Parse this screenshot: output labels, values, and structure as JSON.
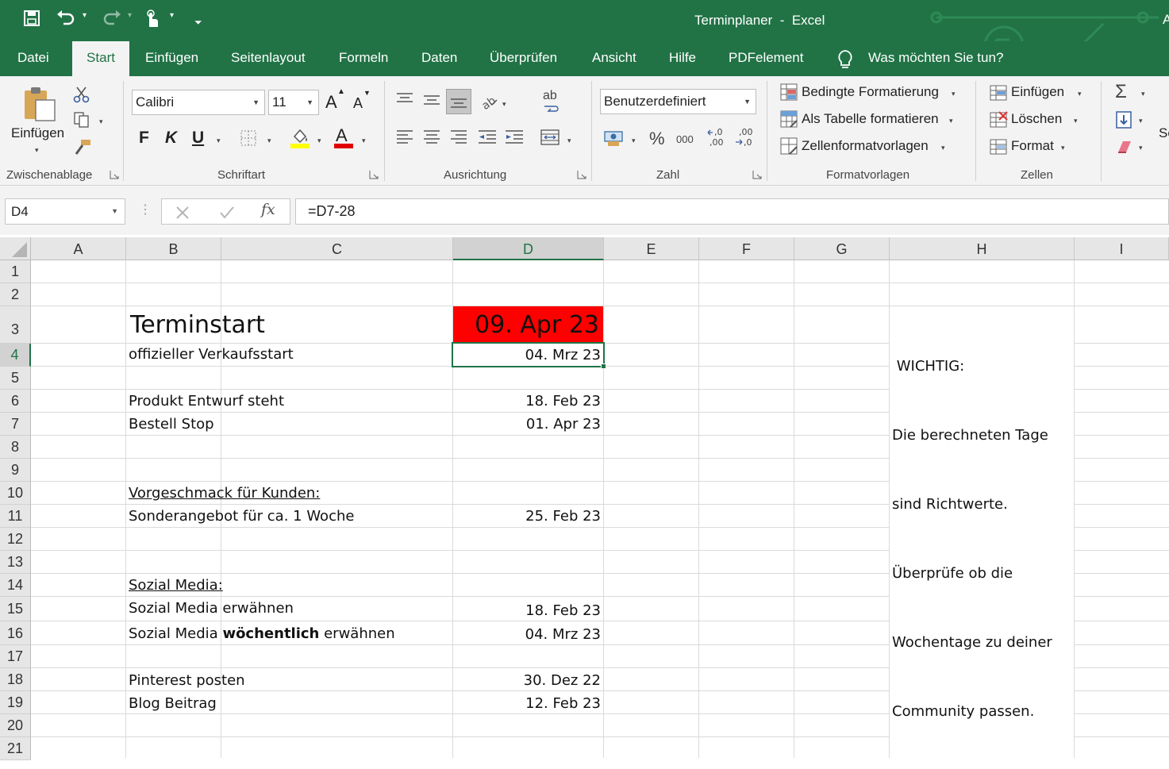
{
  "window": {
    "title": "Terminplaner  -  Excel",
    "title_right_fragment": "A"
  },
  "quick_access": [
    "save-icon",
    "undo-icon",
    "redo-icon",
    "touch-mode-icon",
    "customize-qat-icon"
  ],
  "tabs": [
    {
      "label": "Datei"
    },
    {
      "label": "Start",
      "active": true
    },
    {
      "label": "Einfügen"
    },
    {
      "label": "Seitenlayout"
    },
    {
      "label": "Formeln"
    },
    {
      "label": "Daten"
    },
    {
      "label": "Überprüfen"
    },
    {
      "label": "Ansicht"
    },
    {
      "label": "Hilfe"
    },
    {
      "label": "PDFelement"
    }
  ],
  "tell_me": "Was möchten Sie tun?",
  "ribbon": {
    "clipboard": {
      "label": "Zwischenablage",
      "paste": "Einfügen"
    },
    "font": {
      "label": "Schriftart",
      "font_name": "Calibri",
      "font_size": "11",
      "bold": "F",
      "italic": "K",
      "underline": "U",
      "grow": "A",
      "shrink": "A",
      "font_color_letter": "A"
    },
    "alignment": {
      "label": "Ausrichtung",
      "wrap_glyph": "ab"
    },
    "number": {
      "label": "Zahl",
      "format": "Benutzerdefiniert",
      "percent": "%",
      "thousands": "000",
      "inc_decimal": "←,0 ,00",
      "dec_decimal": ",00 →,0"
    },
    "styles": {
      "label": "Formatvorlagen",
      "conditional": "Bedingte Formatierung",
      "as_table": "Als Tabelle formatieren",
      "cell_styles": "Zellenformatvorlagen"
    },
    "cells": {
      "label": "Zellen",
      "insert": "Einfügen",
      "delete": "Löschen",
      "format": "Format"
    },
    "editing": {
      "partial_label": "Sc"
    }
  },
  "formula_bar": {
    "name_box": "D4",
    "formula": "=D7-28",
    "fx": "fx"
  },
  "columns": [
    "A",
    "B",
    "C",
    "D",
    "E",
    "F",
    "G",
    "H",
    "I"
  ],
  "selected_column": "D",
  "rows": [
    "1",
    "2",
    "3",
    "4",
    "5",
    "6",
    "7",
    "8",
    "9",
    "10",
    "11",
    "12",
    "13",
    "14",
    "15",
    "16",
    "17",
    "18",
    "19",
    "20",
    "21"
  ],
  "selected_row": "4",
  "cells": {
    "B3": "Terminstart",
    "D3": "09. Apr 23",
    "B4": "offizieller Verkaufsstart",
    "D4": "04. Mrz 23",
    "B6": "Produkt Entwurf steht",
    "D6": "18. Feb 23",
    "B7": "Bestell Stop",
    "D7": "01. Apr 23",
    "B10": "Vorgeschmack für Kunden:",
    "B11": "Sonderangebot für ca. 1 Woche",
    "D11": "25. Feb 23",
    "B14": "Sozial Media:",
    "B15": "Sozial Media erwähnen",
    "D15": "18. Feb 23",
    "B16_a": "Sozial Media ",
    "B16_b": "wöchentlich",
    "B16_c": " erwähnen",
    "D16": "04. Mrz 23",
    "B18": "Pinterest posten",
    "D18": "30. Dez 22",
    "B19": "Blog Beitrag",
    "D19": "12. Feb 23",
    "H3_lines": [
      " WICHTIG:",
      "Die berechneten Tage",
      "sind Richtwerte.",
      "Überprüfe ob die",
      "Wochentage zu deiner",
      "Community passen."
    ]
  },
  "colors": {
    "excel_green": "#217346",
    "highlight_red": "#ff0000",
    "fill_yellow": "#ffff00",
    "font_red": "#e00000"
  }
}
